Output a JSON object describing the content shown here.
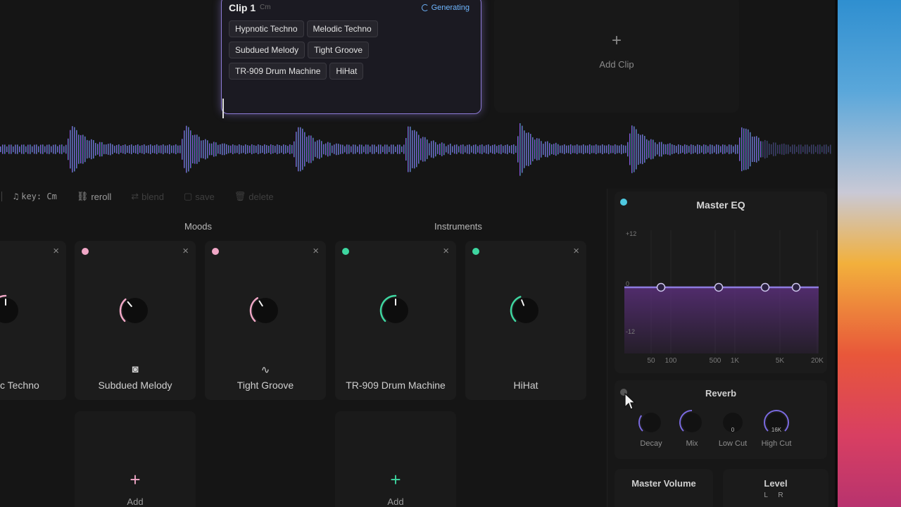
{
  "clip": {
    "title": "Clip 1",
    "key": "Cm",
    "status": "Generating",
    "tags": [
      "Hypnotic Techno",
      "Melodic Techno",
      "Subdued Melody",
      "Tight Groove",
      "TR-909 Drum Machine",
      "HiHat"
    ]
  },
  "add_clip": {
    "icon": "plus-icon",
    "label": "Add Clip"
  },
  "toolbar": {
    "key_label": "key: Cm",
    "reroll": "reroll",
    "blend": "blend",
    "save": "save",
    "delete": "delete"
  },
  "sections": {
    "moods": "Moods",
    "instruments": "Instruments"
  },
  "cards": [
    {
      "label": "c Techno",
      "icon": "music-note-icon",
      "color": "#f0a7c6"
    },
    {
      "label": "Subdued Melody",
      "icon": "speaker-icon",
      "color": "#f0a7c6",
      "value": 0.35
    },
    {
      "label": "Tight Groove",
      "icon": "pulse-icon",
      "color": "#f0a7c6",
      "value": 0.38
    },
    {
      "label": "TR-909 Drum Machine",
      "icon": "drum-icon",
      "color": "#3ed6a0",
      "value": 0.5
    },
    {
      "label": "HiHat",
      "icon": "hihat-icon",
      "color": "#3ed6a0",
      "value": 0.42
    }
  ],
  "add_cards": [
    {
      "label": "Add",
      "color": "#f0a7c6"
    },
    {
      "label": "Add",
      "color": "#3ed6a0"
    }
  ],
  "eq": {
    "title": "Master EQ",
    "y_labels": [
      "+12",
      "0",
      "-12"
    ],
    "x_labels": [
      "50",
      "100",
      "500",
      "1K",
      "5K",
      "20K"
    ],
    "colors": {
      "line": "#8d7be0",
      "fill": "#5a2f7a"
    }
  },
  "reverb": {
    "title": "Reverb",
    "knobs": [
      {
        "label": "Decay",
        "value": 0.3,
        "readout": ""
      },
      {
        "label": "Mix",
        "value": 0.5,
        "readout": ""
      },
      {
        "label": "Low Cut",
        "value": 0.0,
        "readout": "0"
      },
      {
        "label": "High Cut",
        "value": 1.0,
        "readout": "16K"
      }
    ]
  },
  "master_volume": {
    "title": "Master Volume"
  },
  "level": {
    "title": "Level",
    "channels": "L R"
  }
}
